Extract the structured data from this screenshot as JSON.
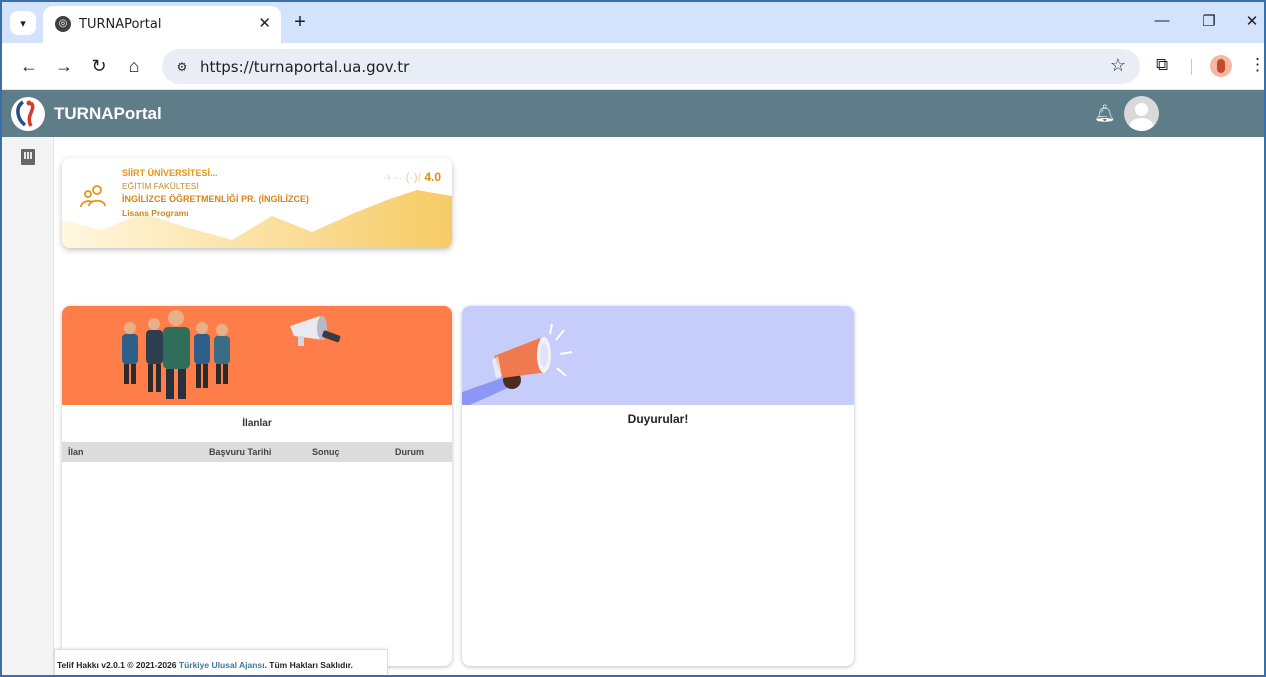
{
  "browser": {
    "tab_title": "TURNAPortal",
    "url": "https://turnaportal.ua.gov.tr",
    "icons": {
      "tab_menu": "chevron-down-icon",
      "favicon": "globe-icon",
      "tab_close": "close-icon",
      "new_tab": "plus-icon",
      "back": "arrow-left-icon",
      "forward": "arrow-right-icon",
      "reload": "reload-icon",
      "home": "home-icon",
      "site_info": "tune-icon",
      "bookmark": "star-icon",
      "extensions": "puzzle-icon",
      "menu": "more-vert-icon",
      "minimize": "minimize-icon",
      "restore": "restore-icon",
      "close_window": "close-icon"
    }
  },
  "app": {
    "title": "TURNAPortal",
    "header_color": "#5f7d89"
  },
  "program": {
    "university": "SİİRT ÜNİVERSİTESİ...",
    "faculty": "EĞİTİM FAKÜLTESİ",
    "department": "İNGİLİZCE ÖĞRETMENLİĞİ PR. (İNGİLİZCE)",
    "level": "Lisans Programı",
    "gpa_obscured": "·› ·· (·)/",
    "gpa_max": "4.0",
    "accent_color": "#f5c24a"
  },
  "ilanlar": {
    "title": "İlanlar",
    "columns": [
      "İlan",
      "Başvuru Tarihi",
      "Sonuç",
      "Durum"
    ],
    "rows": [],
    "banner_color": "#fe7d48"
  },
  "duyurular": {
    "title": "Duyurular!",
    "banner_color": "#c7cdfb"
  },
  "footer": {
    "prefix": "Telif Hakkı v2.0.1 © 2021-2026 ",
    "link": "Türkiye Ulusal Ajansı",
    "suffix": ". Tüm Hakları Saklıdır."
  }
}
